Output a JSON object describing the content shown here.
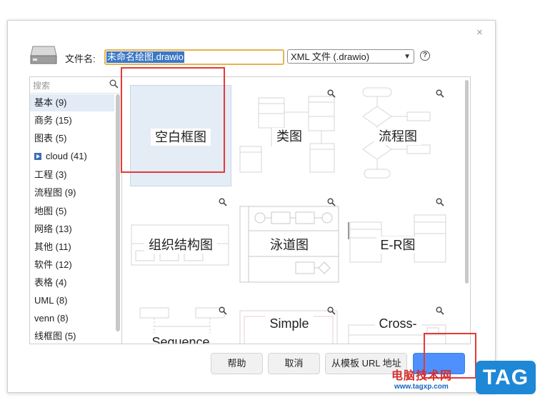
{
  "dialog": {
    "filename_label": "文件名:",
    "filename_value": "未命名绘图.drawio",
    "filetype_value": "XML 文件 (.drawio)",
    "close_glyph": "×",
    "help_glyph": "?"
  },
  "sidebar": {
    "search_placeholder": "搜索",
    "categories": [
      {
        "label": "基本 (9)"
      },
      {
        "label": "商务 (15)"
      },
      {
        "label": "图表 (5)"
      },
      {
        "label": "cloud (41)"
      },
      {
        "label": "工程 (3)"
      },
      {
        "label": "流程图 (9)"
      },
      {
        "label": "地图 (5)"
      },
      {
        "label": "网络 (13)"
      },
      {
        "label": "其他 (11)"
      },
      {
        "label": "软件 (12)"
      },
      {
        "label": "表格 (4)"
      },
      {
        "label": "UML (8)"
      },
      {
        "label": "venn (8)"
      },
      {
        "label": "线框图 (5)"
      }
    ]
  },
  "templates": [
    {
      "label": "空白框图"
    },
    {
      "label": "类图"
    },
    {
      "label": "流程图"
    },
    {
      "label": "组织结构图"
    },
    {
      "label": "泳道图"
    },
    {
      "label": "E-R图"
    },
    {
      "label": "Sequence"
    },
    {
      "label": "Simple"
    },
    {
      "label": "Cross-"
    }
  ],
  "buttons": {
    "help": "帮助",
    "cancel": "取消",
    "from_template_url": "从模板 URL 地址"
  },
  "watermark": {
    "text": "电脑技术网",
    "url": "www.tagxp.com",
    "tag": "TAG"
  },
  "icons": {
    "drive": "hard-drive-icon",
    "search": "search-icon",
    "zoom": "magnifier-icon",
    "cloud": "cloud-play-icon"
  },
  "colors": {
    "primary_button": "#4d90fe",
    "selection": "#3b78c5",
    "highlight_box": "#e53935",
    "selected_tile": "#e4ecf6"
  }
}
